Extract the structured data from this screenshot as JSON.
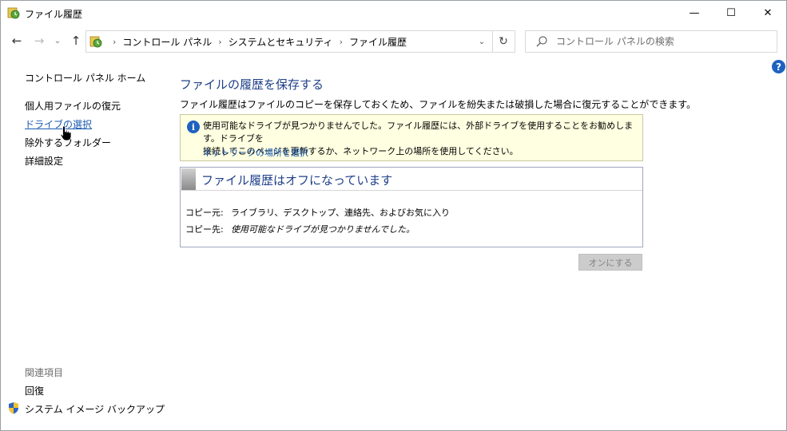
{
  "window": {
    "title": "ファイル履歴",
    "min_glyph": "—",
    "max_glyph": "☐",
    "close_glyph": "✕"
  },
  "nav": {
    "back_glyph": "←",
    "forward_glyph": "→",
    "recent_glyph": "⌄",
    "up_glyph": "↑",
    "breadcrumbs": [
      "コントロール パネル",
      "システムとセキュリティ",
      "ファイル履歴"
    ],
    "crumb_sep": "›",
    "dropdown_glyph": "⌄",
    "refresh_glyph": "↻",
    "search_placeholder": "コントロール パネルの検索"
  },
  "help": {
    "label": "?"
  },
  "left_pane": {
    "home": "コントロール パネル ホーム",
    "restore": "個人用ファイルの復元",
    "select_drive": "ドライブの選択",
    "exclude": "除外するフォルダー",
    "advanced": "詳細設定",
    "related_header": "関連項目",
    "recovery": "回復",
    "system_image": "システム イメージ バックアップ"
  },
  "main": {
    "title": "ファイルの履歴を保存する",
    "description": "ファイル履歴はファイルのコピーを保存しておくため、ファイルを紛失または破損した場合に復元することができます。",
    "info": {
      "icon_glyph": "i",
      "line1": "使用可能なドライブが見つかりませんでした。ファイル履歴には、外部ドライブを使用することをお勧めします。ドライブを",
      "line2": "接続してこのページを更新するか、ネットワーク上の場所を使用してください。",
      "link": "ネットワークの場所を選択"
    },
    "status": {
      "title": "ファイル履歴はオフになっています",
      "copy_from_label": "コピー元:",
      "copy_from_value": "ライブラリ、デスクトップ、連絡先、およびお気に入り",
      "copy_to_label": "コピー先:",
      "copy_to_value": "使用可能なドライブが見つかりませんでした。"
    },
    "turn_on_button": "オンにする"
  },
  "colors": {
    "link_blue": "#1a5bb0",
    "title_blue": "#1e3f88",
    "info_bg": "#ffffe1",
    "help_blue": "#1e62c0"
  }
}
